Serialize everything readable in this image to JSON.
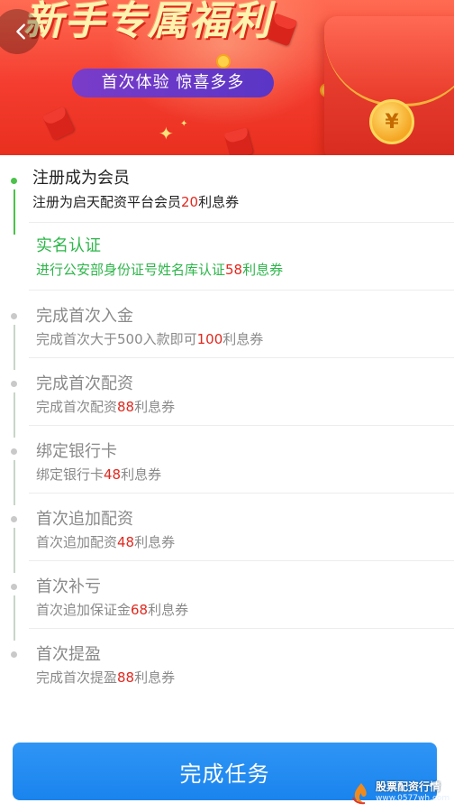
{
  "banner": {
    "title": "新手专属福利",
    "subtitle": "首次体验  惊喜多多",
    "coin_symbol": "¥"
  },
  "tasks": [
    {
      "title": "注册成为会员",
      "desc_prefix": "注册为启天配资平台会员",
      "amount": "20",
      "desc_suffix": "利息券",
      "state": "done"
    },
    {
      "title": "实名认证",
      "desc_prefix": "进行公安部身份证号姓名库认证",
      "amount": "58",
      "desc_suffix": "利息券",
      "state": "current"
    },
    {
      "title": "完成首次入金",
      "desc_prefix": "完成首次大于500入款即可",
      "amount": "100",
      "desc_suffix": "利息券",
      "state": "pending"
    },
    {
      "title": "完成首次配资",
      "desc_prefix": "完成首次配资",
      "amount": "88",
      "desc_suffix": "利息券",
      "state": "pending"
    },
    {
      "title": "绑定银行卡",
      "desc_prefix": "绑定银行卡",
      "amount": "48",
      "desc_suffix": "利息券",
      "state": "pending"
    },
    {
      "title": "首次追加配资",
      "desc_prefix": "首次追加配资",
      "amount": "48",
      "desc_suffix": "利息券",
      "state": "pending"
    },
    {
      "title": "首次补亏",
      "desc_prefix": "首次追加保证金",
      "amount": "68",
      "desc_suffix": "利息券",
      "state": "pending"
    },
    {
      "title": "首次提盈",
      "desc_prefix": "完成首次提盈",
      "amount": "88",
      "desc_suffix": "利息券",
      "state": "pending"
    }
  ],
  "complete_button": {
    "label": "完成任务"
  },
  "watermark": {
    "name": "股票配资行情",
    "url": "www.0577wh.com"
  },
  "colors": {
    "accent_blue": "#1a84ee",
    "done_green": "#4cc14b",
    "current_green": "#2db64a",
    "amount_red": "#e0281e",
    "pending_gray": "#8a8a8a"
  },
  "icons": {
    "back": "chevron-left-icon",
    "coin": "yen-coin-icon"
  }
}
